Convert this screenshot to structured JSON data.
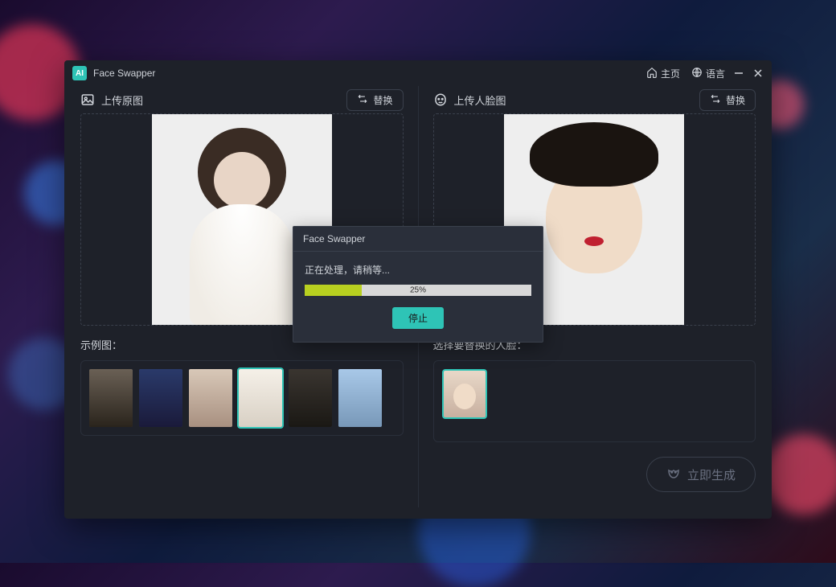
{
  "app": {
    "name": "Face Swapper",
    "icon_text": "AI"
  },
  "titlebar": {
    "home": "主页",
    "language": "语言"
  },
  "left": {
    "title": "上传原图",
    "swap": "替换",
    "examples_label": "示例图："
  },
  "right": {
    "title": "上传人脸图",
    "swap": "替换",
    "select_face_label": "选择要替换的人脸："
  },
  "generate_label": "立即生成",
  "dialog": {
    "title": "Face Swapper",
    "message": "正在处理，请稍等...",
    "percent": "25%",
    "stop": "停止"
  },
  "example_thumbs": [
    {
      "name": "example-1",
      "cls": "tf-suit"
    },
    {
      "name": "example-2",
      "cls": "tf-armor"
    },
    {
      "name": "example-3",
      "cls": "tf-model"
    },
    {
      "name": "example-4",
      "cls": "tf-bride",
      "selected": true
    },
    {
      "name": "example-5",
      "cls": "tf-casual"
    },
    {
      "name": "example-6",
      "cls": "tf-beach"
    }
  ]
}
